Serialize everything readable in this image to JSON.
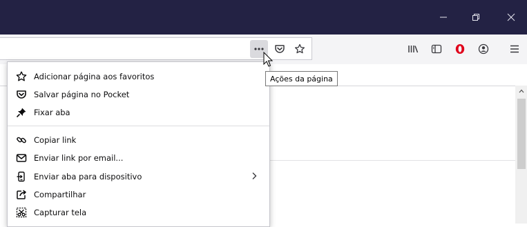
{
  "window": {
    "minimize_icon": "minimize-icon",
    "restore_icon": "restore-icon",
    "close_icon": "close-icon"
  },
  "url_actions": {
    "page_actions_icon": "ellipsis-icon",
    "pocket_icon": "pocket-icon",
    "bookmark_icon": "star-icon"
  },
  "toolbar": {
    "icons": [
      "library-icon",
      "sidebar-icon",
      "opera-icon",
      "account-icon",
      "hamburger-menu-icon"
    ],
    "brand_color": "#e0001b"
  },
  "tooltip": {
    "text": "Ações da página"
  },
  "menu": {
    "items": [
      {
        "label": "Adicionar página aos favoritos",
        "icon": "star-icon"
      },
      {
        "label": "Salvar página no Pocket",
        "icon": "pocket-icon"
      },
      {
        "label": "Fixar aba",
        "icon": "pin-icon"
      },
      {
        "label": "Copiar link",
        "icon": "link-icon"
      },
      {
        "label": "Enviar link por email...",
        "icon": "mail-icon"
      },
      {
        "label": "Enviar aba para dispositivo",
        "icon": "device-icon",
        "has_submenu": true
      },
      {
        "label": "Compartilhar",
        "icon": "share-icon"
      },
      {
        "label": "Capturar tela",
        "icon": "screenshot-icon"
      }
    ]
  },
  "colors": {
    "titlebar": "#232244",
    "toolbar": "#f4f4f6"
  }
}
